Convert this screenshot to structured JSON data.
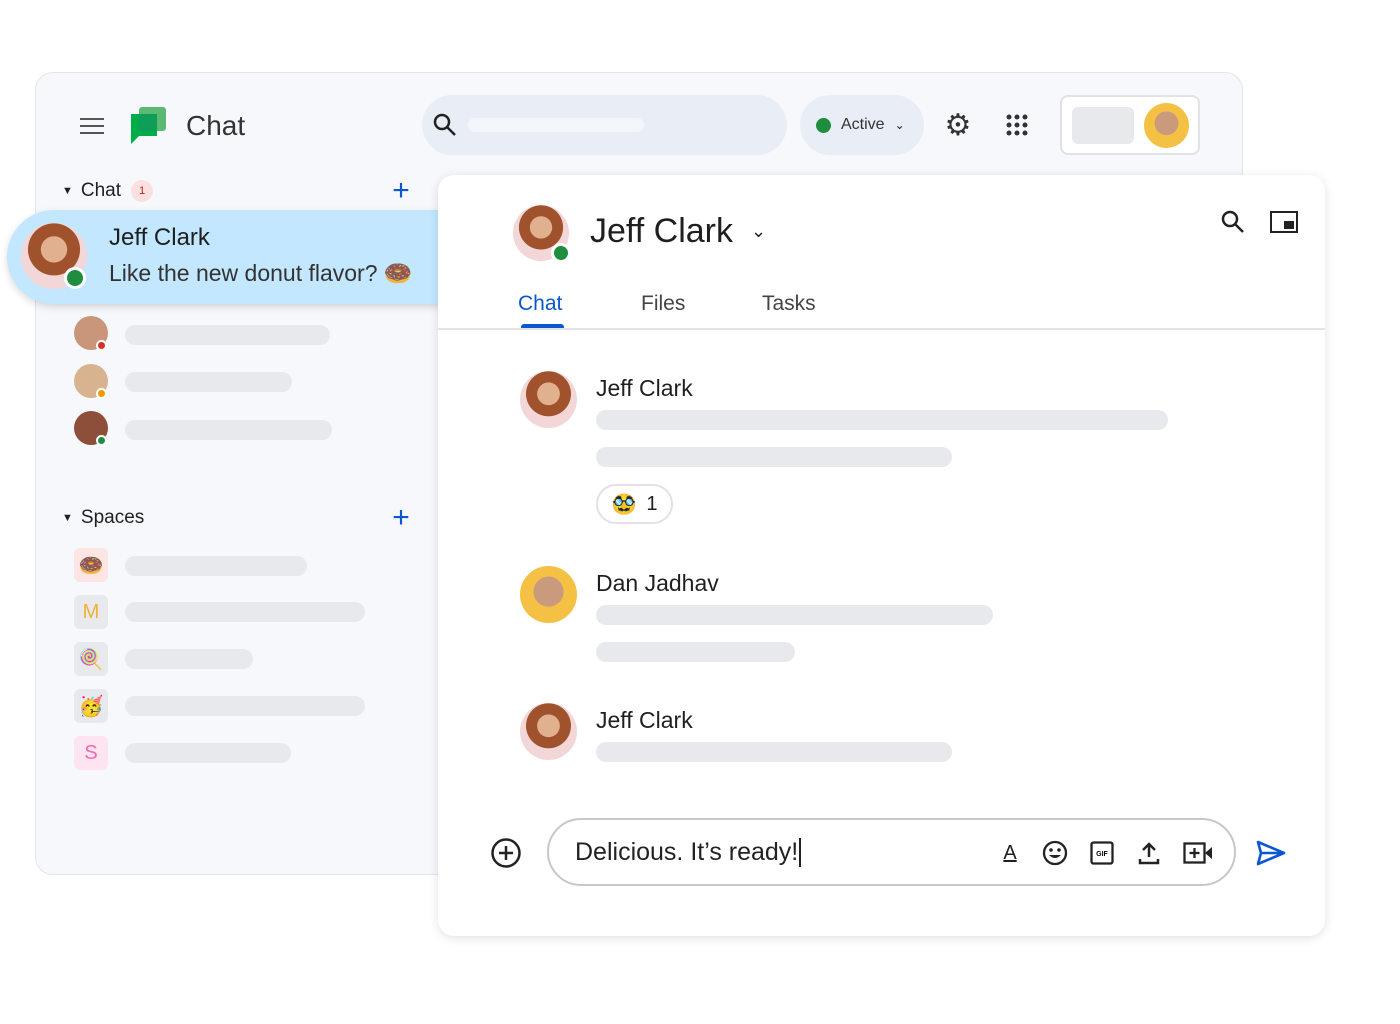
{
  "app": {
    "title": "Chat"
  },
  "header": {
    "status_label": "Active",
    "status_color": "#1e8e3e"
  },
  "sidebar": {
    "chat_section": {
      "label": "Chat",
      "badge": "1"
    },
    "selected_chat": {
      "name": "Jeff Clark",
      "preview": "Like the new donut flavor? 🍩"
    },
    "spaces_section": {
      "label": "Spaces"
    },
    "spaces": [
      {
        "icon": "🍩"
      },
      {
        "icon": "M"
      },
      {
        "icon": "🍭"
      },
      {
        "icon": "🥳"
      },
      {
        "icon": "S"
      }
    ]
  },
  "conversation": {
    "title": "Jeff Clark",
    "tabs": [
      {
        "label": "Chat",
        "active": true
      },
      {
        "label": "Files"
      },
      {
        "label": "Tasks"
      }
    ],
    "messages": [
      {
        "sender": "Jeff Clark",
        "reaction": {
          "emoji": "🥸",
          "count": "1"
        }
      },
      {
        "sender": "Dan Jadhav"
      },
      {
        "sender": "Jeff Clark"
      }
    ],
    "composer": {
      "value": "Delicious. It’s ready!"
    }
  },
  "colors": {
    "accent": "#0b57d0",
    "selected": "#c2e7ff",
    "unread": "#b3261e"
  }
}
